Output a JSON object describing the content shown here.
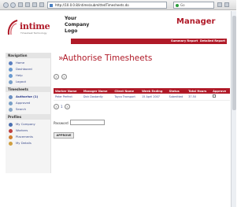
{
  "browser": {
    "url": "http://10.0.0.8/intime/submittedTimesheets.do",
    "search_placeholder": "Go"
  },
  "brand": {
    "name": "intime",
    "tagline": "Timesheet Technology",
    "color": "#b01a28"
  },
  "header": {
    "company_logo_lines": [
      "Your",
      "Company",
      "Logo"
    ],
    "role_title": "Manager",
    "links": [
      "Summary Report",
      "Detailed Report"
    ]
  },
  "sidebar": {
    "sections": [
      {
        "title": "Navigation",
        "items": [
          "Home",
          "Dashboard",
          "Help",
          "Logout"
        ]
      },
      {
        "title": "Timesheets",
        "items": [
          "Authorise (1)",
          "Approved",
          "Search"
        ]
      },
      {
        "title": "Profiles",
        "items": [
          "My Company",
          "Workers",
          "Placements",
          "My Details"
        ]
      }
    ]
  },
  "main": {
    "title_chevron": "»",
    "title": "Authorise Timesheets",
    "table": {
      "headers": [
        "Worker Name",
        "Manager Name",
        "Client Name",
        "Week Ending",
        "Status",
        "Total Hours",
        "Approve"
      ],
      "rows": [
        [
          "Peter Perfect",
          "Dick Dastardly",
          "Toyco Transport",
          "15 April 2007",
          "Submitted",
          "37.50"
        ]
      ]
    },
    "page_indicator": "1",
    "password_label": "Password",
    "approve_button": "APPROVE"
  }
}
